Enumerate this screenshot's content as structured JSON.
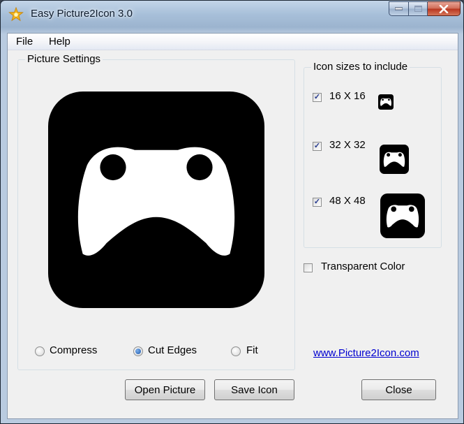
{
  "window": {
    "title": "Easy Picture2Icon 3.0"
  },
  "menu": {
    "file": "File",
    "help": "Help"
  },
  "picture_settings": {
    "legend": "Picture Settings",
    "options": [
      "Compress",
      "Cut Edges",
      "Fit"
    ],
    "selected": "Cut Edges"
  },
  "icon_sizes": {
    "legend": "Icon sizes to include",
    "sizes": [
      {
        "label": "16 X 16",
        "checked": true
      },
      {
        "label": "32 X 32",
        "checked": true
      },
      {
        "label": "48 X 48",
        "checked": true
      }
    ]
  },
  "transparent_color": {
    "label": "Transparent Color",
    "checked": false
  },
  "link": {
    "text": "www.Picture2Icon.com"
  },
  "buttons": {
    "open": "Open Picture",
    "save": "Save Icon",
    "close": "Close"
  },
  "icons": {
    "app": "star-icon",
    "preview": "gamepad-icon"
  },
  "colors": {
    "link": "#0000d0",
    "icon_bg": "#000000",
    "icon_fg": "#ffffff"
  }
}
